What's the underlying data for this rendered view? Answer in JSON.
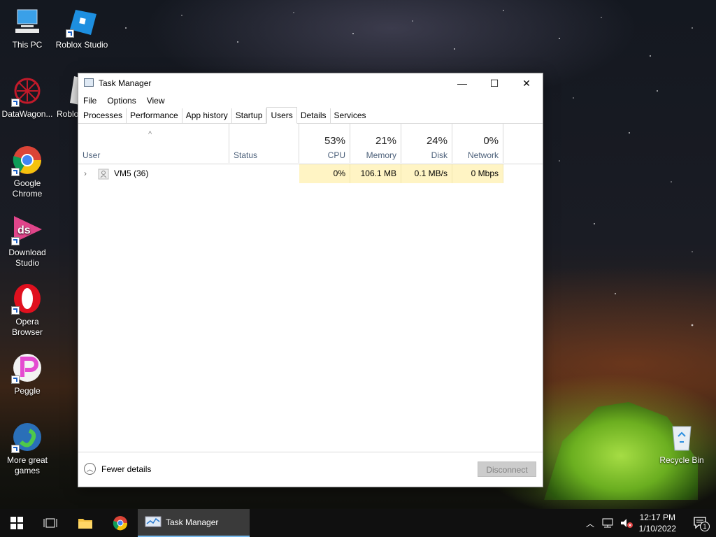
{
  "desktop": {
    "icons": [
      {
        "label": "This PC",
        "icon": "this-pc-icon"
      },
      {
        "label": "Roblox Studio",
        "icon": "roblox-studio-icon"
      },
      {
        "label": "DataWagon...",
        "icon": "datawagon-icon"
      },
      {
        "label": "Roblo",
        "icon": "roblox-icon"
      },
      {
        "label": "Google Chrome",
        "icon": "chrome-icon"
      },
      {
        "label": "Download Studio",
        "icon": "download-studio-icon"
      },
      {
        "label": "Opera Browser",
        "icon": "opera-icon"
      },
      {
        "label": "Peggle",
        "icon": "peggle-icon"
      },
      {
        "label": "More great games",
        "icon": "games-icon"
      },
      {
        "label": "Recycle Bin",
        "icon": "recycle-bin-icon"
      }
    ]
  },
  "window": {
    "title": "Task Manager",
    "controls": {
      "minimize": "—",
      "maximize": "☐",
      "close": "✕"
    },
    "menu": [
      "File",
      "Options",
      "View"
    ],
    "tabs": [
      "Processes",
      "Performance",
      "App history",
      "Startup",
      "Users",
      "Details",
      "Services"
    ],
    "active_tab": "Users",
    "columns": {
      "user": {
        "name": "User"
      },
      "status": {
        "name": "Status"
      },
      "cpu": {
        "name": "CPU",
        "pct": "53%"
      },
      "memory": {
        "name": "Memory",
        "pct": "21%"
      },
      "disk": {
        "name": "Disk",
        "pct": "24%"
      },
      "network": {
        "name": "Network",
        "pct": "0%"
      }
    },
    "rows": [
      {
        "user": "VM5 (36)",
        "status": "",
        "cpu": "0%",
        "memory": "106.1 MB",
        "disk": "0.1 MB/s",
        "network": "0 Mbps"
      }
    ],
    "footer": {
      "fewer_details": "Fewer details",
      "disconnect": "Disconnect"
    }
  },
  "taskbar": {
    "active_app": "Task Manager",
    "time": "12:17 PM",
    "date": "1/10/2022",
    "notification_count": "1"
  },
  "colors": {
    "highlight_cell": "#fff4c4",
    "taskbar": "#101010",
    "accent": "#76b9ed"
  }
}
